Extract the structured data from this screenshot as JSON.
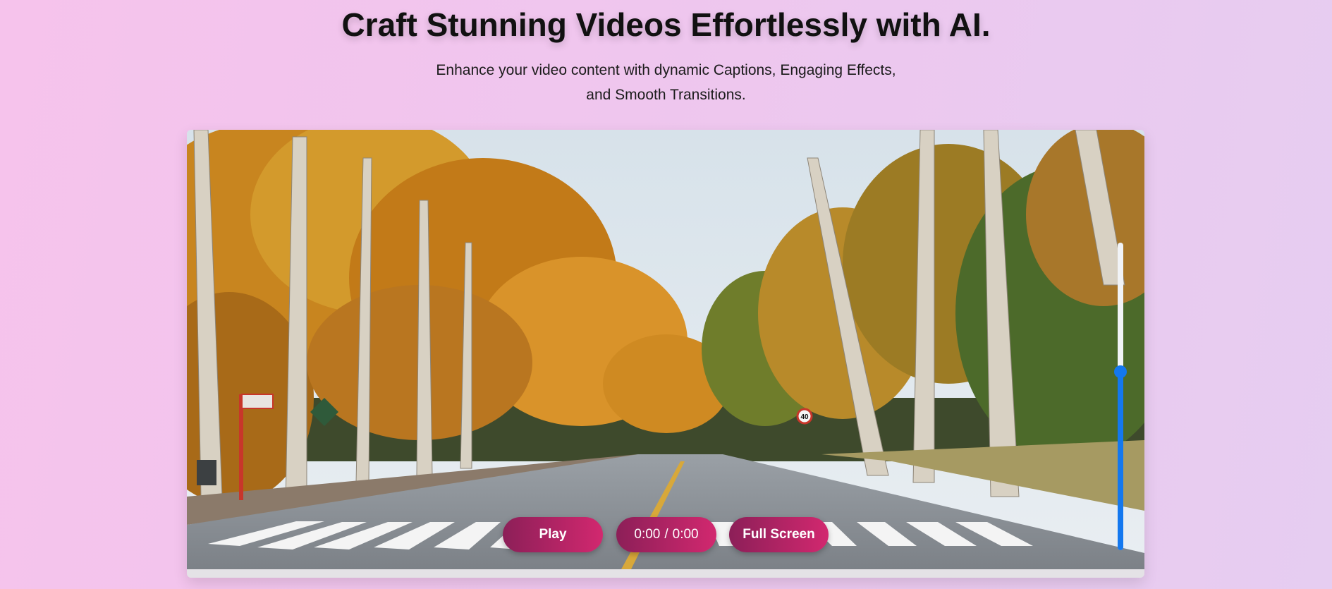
{
  "hero": {
    "title": "Craft Stunning Videos Effortlessly with AI.",
    "subtitle_line1": "Enhance your video content with dynamic Captions, Engaging Effects,",
    "subtitle_line2": "and Smooth Transitions."
  },
  "player": {
    "video_scene": "autumn tree-lined road with crosswalk",
    "road_sign_speed": "40",
    "play_label": "Play",
    "current_time": "0:00",
    "time_separator": "/",
    "duration": "0:00",
    "fullscreen_label": "Full Screen",
    "volume_level": 0.58
  },
  "colors": {
    "button_gradient_start": "#8c1f58",
    "button_gradient_end": "#d2286f",
    "volume_accent": "#1478ef"
  }
}
